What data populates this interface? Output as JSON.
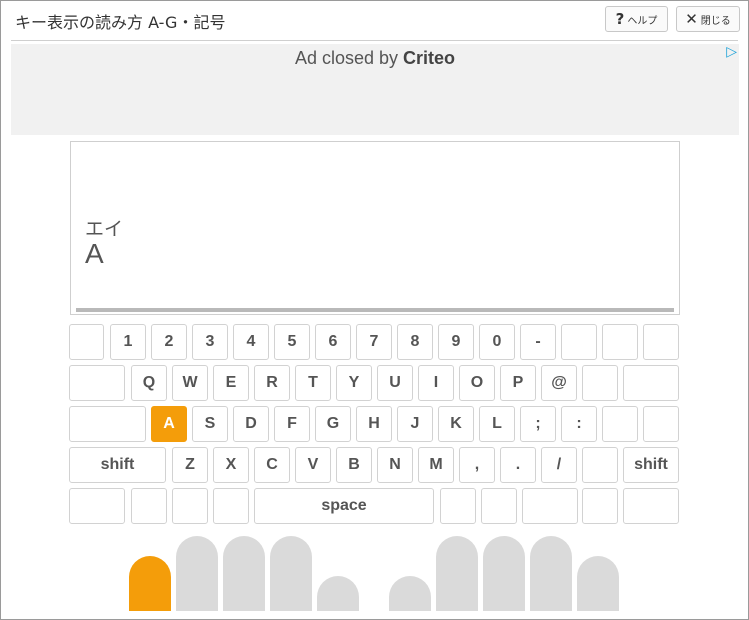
{
  "window": {
    "title": "キー表示の読み方 A-G・記号",
    "help_label": "ヘルプ",
    "help_icon": "?",
    "close_label": "閉じる",
    "close_icon": "✕"
  },
  "ad": {
    "text_prefix": "Ad closed by ",
    "brand": "Criteo",
    "icon": "▷"
  },
  "display": {
    "reading": "エイ",
    "character": "A"
  },
  "keyboard": {
    "row1": [
      "",
      "1",
      "2",
      "3",
      "4",
      "5",
      "6",
      "7",
      "8",
      "9",
      "0",
      "-",
      "",
      "",
      ""
    ],
    "row2": [
      "",
      "Q",
      "W",
      "E",
      "R",
      "T",
      "Y",
      "U",
      "I",
      "O",
      "P",
      "@",
      "",
      ""
    ],
    "row3": [
      "",
      "A",
      "S",
      "D",
      "F",
      "G",
      "H",
      "J",
      "K",
      "L",
      ";",
      ":",
      "",
      ""
    ],
    "row4": [
      "shift",
      "Z",
      "X",
      "C",
      "V",
      "B",
      "N",
      "M",
      ",",
      ".",
      "/",
      "",
      "shift"
    ],
    "row5": [
      "",
      "",
      "",
      "",
      "space",
      "",
      "",
      "",
      "",
      ""
    ],
    "active_key": "A"
  },
  "hands": {
    "active_finger": "left-pinky",
    "colors": {
      "active": "#f49d0a",
      "inactive": "#dadada"
    }
  }
}
